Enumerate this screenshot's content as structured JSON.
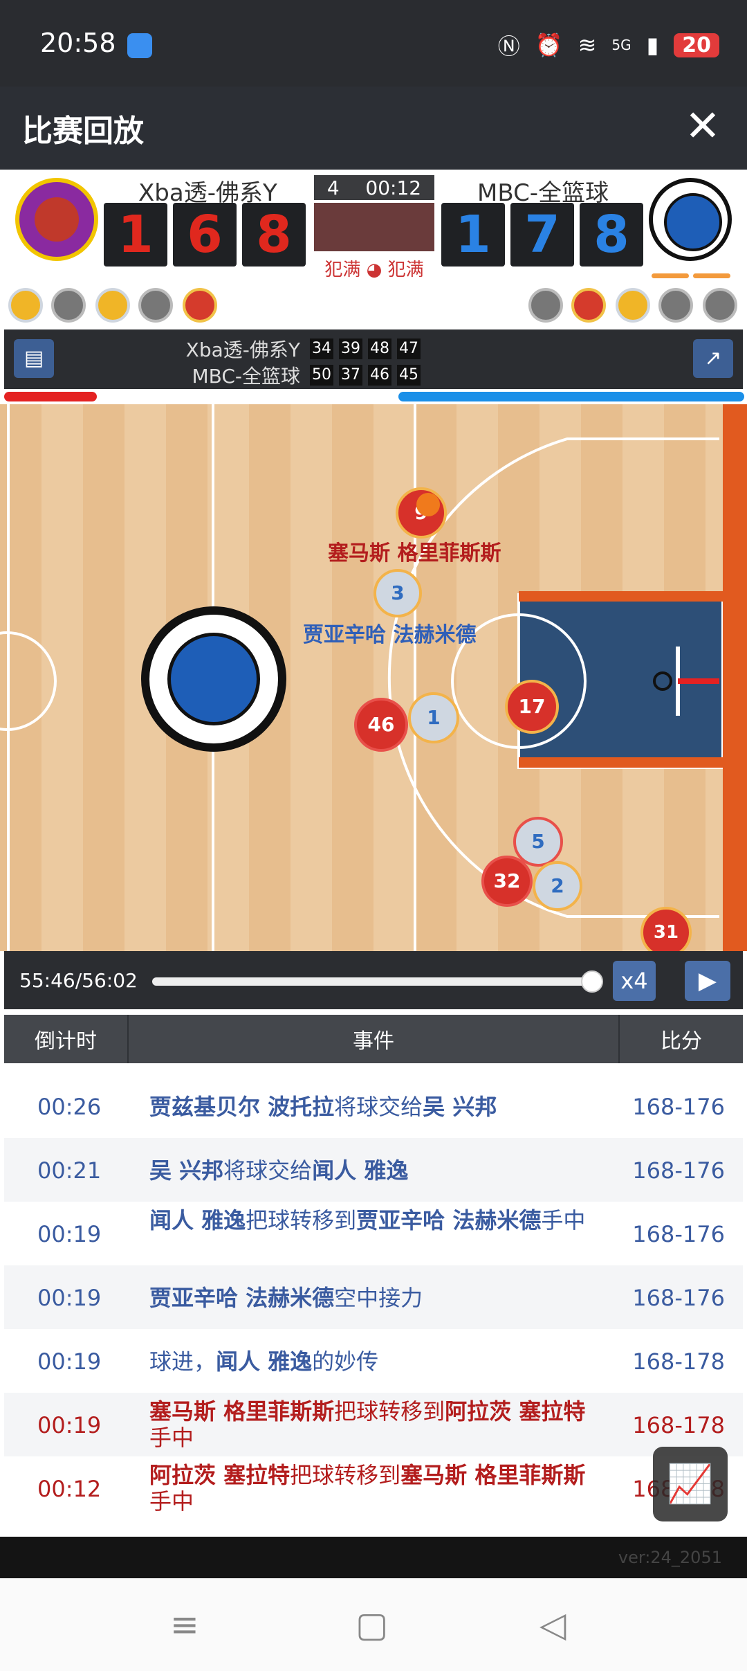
{
  "status": {
    "time": "20:58",
    "battery": "20",
    "signal": "5G"
  },
  "title": "比赛回放",
  "close_icon": "✕",
  "scoreboard": {
    "home_name": "Xba透-佛系Y",
    "away_name": "MBC-全篮球",
    "home_digits": [
      "1",
      "6",
      "8"
    ],
    "away_digits": [
      "1",
      "7",
      "8"
    ],
    "quarter": "4",
    "clock": "00:12",
    "home_foul": "犯满",
    "away_foul": "犯满"
  },
  "quarters": {
    "home": {
      "name": "Xba透-佛系Y",
      "scores": [
        "34",
        "39",
        "48",
        "47"
      ]
    },
    "away": {
      "name": "MBC-全篮球",
      "scores": [
        "50",
        "37",
        "46",
        "45"
      ]
    }
  },
  "court": {
    "labels": [
      "塞马斯 格里菲斯斯",
      "贾亚辛哈 法赫米德"
    ],
    "red_players": [
      "9",
      "46",
      "17",
      "32",
      "31"
    ],
    "blue_players": [
      "3",
      "1",
      "5",
      "2"
    ]
  },
  "playback": {
    "time": "55:46/56:02",
    "speed": "x4",
    "progress": 0.97
  },
  "table": {
    "headers": [
      "倒计时",
      "事件",
      "比分"
    ]
  },
  "events": [
    {
      "t": "00:26",
      "parts": [
        {
          "b": "贾兹基贝尔 波托拉"
        },
        {
          "n": "将球交给"
        },
        {
          "b": "吴 兴邦"
        }
      ],
      "s": "168-176",
      "team": "blue"
    },
    {
      "t": "00:21",
      "parts": [
        {
          "b": "吴 兴邦"
        },
        {
          "n": "将球交给"
        },
        {
          "b": "闻人 雅逸"
        }
      ],
      "s": "168-176",
      "team": "blue"
    },
    {
      "t": "00:19",
      "parts": [
        {
          "b": "闻人 雅逸"
        },
        {
          "n": "把球转移到"
        },
        {
          "b": "贾亚辛哈 法赫米德"
        },
        {
          "n": "手中"
        }
      ],
      "s": "168-176",
      "team": "blue"
    },
    {
      "t": "00:19",
      "parts": [
        {
          "b": "贾亚辛哈 法赫米德"
        },
        {
          "n": "空中接力"
        }
      ],
      "s": "168-176",
      "team": "blue"
    },
    {
      "t": "00:19",
      "parts": [
        {
          "n": "球进，"
        },
        {
          "b": "闻人 雅逸"
        },
        {
          "n": "的妙传"
        }
      ],
      "s": "168-178",
      "team": "blue"
    },
    {
      "t": "00:19",
      "parts": [
        {
          "b": "塞马斯 格里菲斯斯"
        },
        {
          "n": "把球转移到"
        },
        {
          "b": "阿拉茨 塞拉特"
        },
        {
          "n": "手中"
        }
      ],
      "s": "168-178",
      "team": "red"
    },
    {
      "t": "00:12",
      "parts": [
        {
          "b": "阿拉茨 塞拉特"
        },
        {
          "n": "把球转移到"
        },
        {
          "b": "塞马斯 格里菲斯斯"
        },
        {
          "n": "手中"
        }
      ],
      "s": "168-178",
      "team": "red"
    }
  ],
  "version": "ver:24_2051",
  "nav": [
    "≡",
    "▢",
    "◁"
  ]
}
